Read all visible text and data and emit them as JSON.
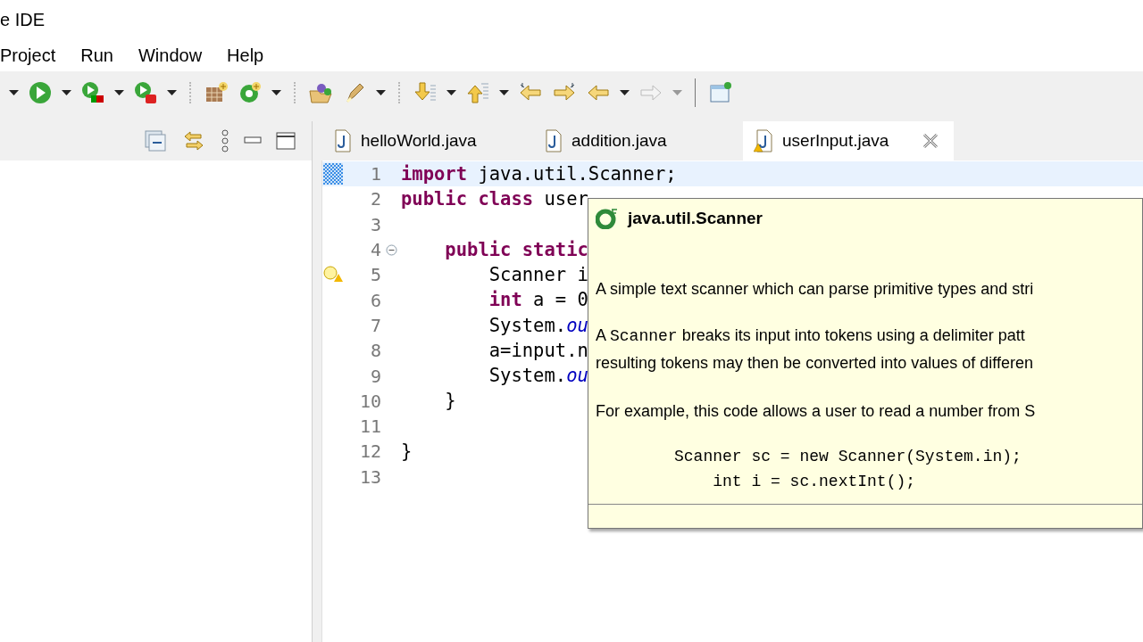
{
  "window": {
    "title": "e IDE"
  },
  "menu": [
    {
      "label": "Project"
    },
    {
      "label": "Run"
    },
    {
      "label": "Window"
    },
    {
      "label": "Help"
    }
  ],
  "editor": {
    "tabs": [
      {
        "label": "helloWorld.java",
        "selected": false,
        "warning": false
      },
      {
        "label": "addition.java",
        "selected": false,
        "warning": false
      },
      {
        "label": "userInput.java",
        "selected": true,
        "warning": true
      }
    ],
    "lines": [
      {
        "number": "1",
        "current": true,
        "warning": false,
        "segments": [
          {
            "kind": "keyword",
            "text": "import"
          },
          {
            "kind": "plain",
            "text": " java.util.Scanner;"
          }
        ]
      },
      {
        "number": "2",
        "current": false,
        "warning": false,
        "segments": [
          {
            "kind": "keyword",
            "text": "public class"
          },
          {
            "kind": "plain",
            "text": " user"
          }
        ]
      },
      {
        "number": "3",
        "current": false,
        "warning": false
      },
      {
        "number": "4",
        "current": false,
        "warning": false,
        "fold_expanded": true,
        "segments": [
          {
            "kind": "keyword",
            "text": "    public static"
          }
        ]
      },
      {
        "number": "5",
        "current": false,
        "warning": true,
        "segments": [
          {
            "kind": "plain",
            "text": "        Scanner i"
          }
        ]
      },
      {
        "number": "6",
        "current": false,
        "warning": false,
        "segments": [
          {
            "kind": "keyword",
            "text": "        int"
          },
          {
            "kind": "plain",
            "text": " a = 0"
          }
        ]
      },
      {
        "number": "7",
        "current": false,
        "warning": false,
        "segments": [
          {
            "kind": "plain",
            "text": "        System."
          },
          {
            "kind": "field",
            "text": "ou"
          }
        ]
      },
      {
        "number": "8",
        "current": false,
        "warning": false,
        "segments": [
          {
            "kind": "plain",
            "text": "        a=input.n"
          }
        ]
      },
      {
        "number": "9",
        "current": false,
        "warning": false,
        "segments": [
          {
            "kind": "plain",
            "text": "        System."
          },
          {
            "kind": "field",
            "text": "ou"
          }
        ]
      },
      {
        "number": "10",
        "current": false,
        "warning": false,
        "segments": [
          {
            "kind": "plain",
            "text": "    }"
          }
        ]
      },
      {
        "number": "11",
        "current": false,
        "warning": false
      },
      {
        "number": "12",
        "current": false,
        "warning": false,
        "segments": [
          {
            "kind": "plain",
            "text": "}"
          }
        ]
      },
      {
        "number": "13",
        "current": false,
        "warning": false
      }
    ]
  },
  "hover_popup": {
    "title": "java.util.Scanner",
    "paragraphs": [
      {
        "kind": "text",
        "segments": [
          {
            "kind": "text",
            "text": "A simple text scanner which can parse primitive types and stri"
          }
        ]
      },
      {
        "kind": "text",
        "segments": [
          {
            "kind": "text",
            "text": "A "
          },
          {
            "kind": "code",
            "text": "Scanner"
          },
          {
            "kind": "text",
            "text": " breaks its input into tokens using a delimiter patt"
          }
        ]
      },
      {
        "kind": "text",
        "segments": [
          {
            "kind": "text",
            "text": "resulting tokens may then be converted into values of differen"
          }
        ]
      },
      {
        "kind": "text",
        "segments": [
          {
            "kind": "text",
            "text": "For example, this code allows a user to read a number from S"
          }
        ]
      },
      {
        "kind": "code",
        "text": "Scanner sc = new Scanner(System.in);"
      },
      {
        "kind": "code",
        "text": "    int i = sc.nextInt();"
      }
    ]
  }
}
